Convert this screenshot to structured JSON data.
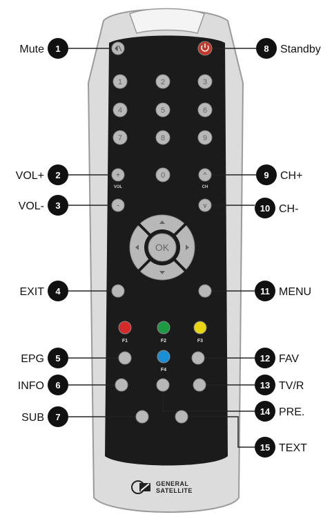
{
  "callouts": [
    {
      "number": "1",
      "label": "Mute"
    },
    {
      "number": "2",
      "label": "VOL+"
    },
    {
      "number": "3",
      "label": "VOL-"
    },
    {
      "number": "4",
      "label": "EXIT"
    },
    {
      "number": "5",
      "label": "EPG"
    },
    {
      "number": "6",
      "label": "INFO"
    },
    {
      "number": "7",
      "label": "SUB"
    },
    {
      "number": "8",
      "label": "Standby"
    },
    {
      "number": "9",
      "label": "CH+"
    },
    {
      "number": "10",
      "label": "CH-"
    },
    {
      "number": "11",
      "label": "MENU"
    },
    {
      "number": "12",
      "label": "FAV"
    },
    {
      "number": "13",
      "label": "TV/R"
    },
    {
      "number": "14",
      "label": "PRE."
    },
    {
      "number": "15",
      "label": "TEXT"
    }
  ],
  "remote": {
    "digits": [
      "1",
      "2",
      "3",
      "4",
      "5",
      "6",
      "7",
      "8",
      "9",
      "0"
    ],
    "vol_label": "VOL",
    "ch_label": "CH",
    "ok_label": "OK",
    "function_keys": [
      "F1",
      "F2",
      "F3",
      "F4"
    ],
    "brand": [
      "GENERAL",
      "SATELLITE"
    ]
  },
  "colors": {
    "body": "#dcdcdc",
    "panel": "#1b1b1b",
    "key": "#b8b8b8",
    "power": "#c0392b",
    "f1": "#d42a2a",
    "f2": "#1e9a45",
    "f3": "#e8d614",
    "f4": "#1b8fd6"
  }
}
